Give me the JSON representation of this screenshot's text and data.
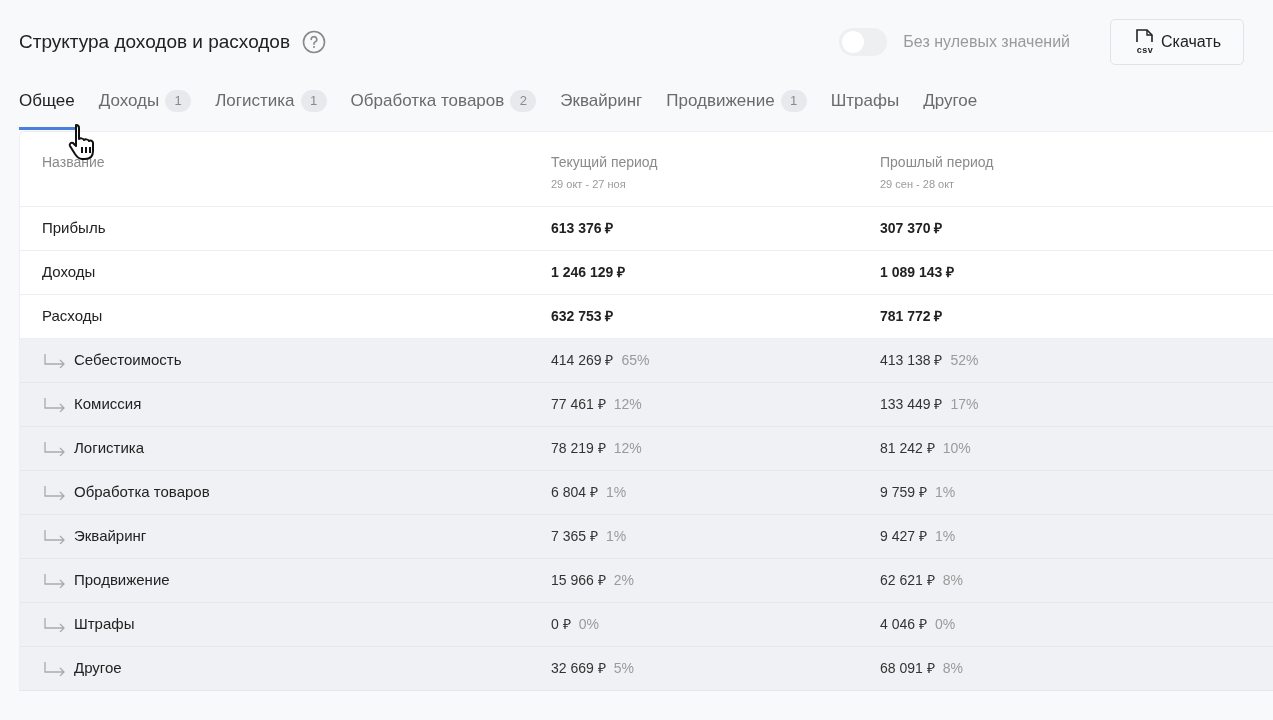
{
  "header": {
    "title": "Структура доходов и расходов",
    "toggle": {
      "label": "Без нулевых значений",
      "on": false
    },
    "download_button": {
      "icon_text": "csv",
      "label": "Скачать"
    }
  },
  "tabs": [
    {
      "label": "Общее",
      "selected": true
    },
    {
      "label": "Доходы",
      "badge": "1",
      "selected": false
    },
    {
      "label": "Логистика",
      "badge": "1",
      "selected": false
    },
    {
      "label": "Обработка товаров",
      "badge": "2",
      "selected": false
    },
    {
      "label": "Эквайринг",
      "selected": false
    },
    {
      "label": "Продвижение",
      "badge": "1",
      "selected": false
    },
    {
      "label": "Штрафы",
      "selected": false
    },
    {
      "label": "Другое",
      "selected": false
    }
  ],
  "table": {
    "columns": [
      {
        "label": "Название"
      },
      {
        "label": "Текущий период",
        "sublabel": "29 окт - 27 ноя"
      },
      {
        "label": "Прошлый период",
        "sublabel": "29 сен - 28 окт"
      }
    ],
    "rows": [
      {
        "name": "Прибыль",
        "current": "613 376 ₽",
        "previous": "307 370 ₽"
      },
      {
        "name": "Доходы",
        "current": "1 246 129 ₽",
        "previous": "1 089 143 ₽"
      },
      {
        "name": "Расходы",
        "current": "632 753 ₽",
        "previous": "781 772 ₽",
        "children": [
          {
            "name": "Себестоимость",
            "current": "414 269 ₽",
            "current_share": "65%",
            "previous": "413 138 ₽",
            "previous_share": "52%"
          },
          {
            "name": "Комиссия",
            "current": "77 461 ₽",
            "current_share": "12%",
            "previous": "133 449 ₽",
            "previous_share": "17%"
          },
          {
            "name": "Логистика",
            "current": "78 219 ₽",
            "current_share": "12%",
            "previous": "81 242 ₽",
            "previous_share": "10%"
          },
          {
            "name": "Обработка товаров",
            "current": "6 804 ₽",
            "current_share": "1%",
            "previous": "9 759 ₽",
            "previous_share": "1%"
          },
          {
            "name": "Эквайринг",
            "current": "7 365 ₽",
            "current_share": "1%",
            "previous": "9 427 ₽",
            "previous_share": "1%"
          },
          {
            "name": "Продвижение",
            "current": "15 966 ₽",
            "current_share": "2%",
            "previous": "62 621 ₽",
            "previous_share": "8%"
          },
          {
            "name": "Штрафы",
            "current": "0 ₽",
            "current_share": "0%",
            "previous": "4 046 ₽",
            "previous_share": "0%"
          },
          {
            "name": "Другое",
            "current": "32 669 ₽",
            "current_share": "5%",
            "previous": "68 091 ₽",
            "previous_share": "8%"
          }
        ]
      }
    ]
  }
}
